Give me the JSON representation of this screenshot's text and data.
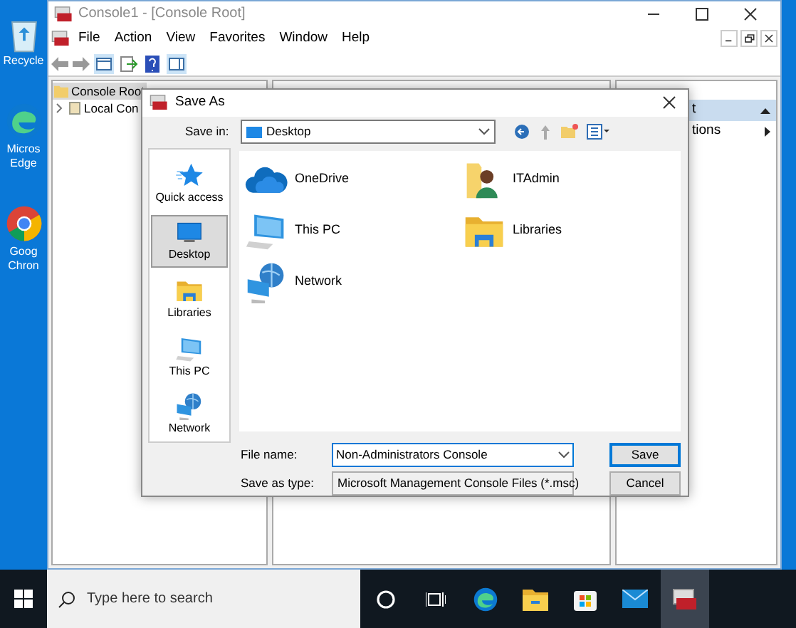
{
  "desktop_icons": [
    {
      "kind": "recycle",
      "lines": [
        "Recycle"
      ]
    },
    {
      "kind": "edge",
      "lines": [
        "Micros",
        "Edge"
      ]
    },
    {
      "kind": "chrome",
      "lines": [
        "Goog",
        "Chron"
      ]
    }
  ],
  "console": {
    "title": "Console1 - [Console Root]",
    "menu": [
      "File",
      "Action",
      "View",
      "Favorites",
      "Window",
      "Help"
    ],
    "tree": [
      {
        "label": "Console Root",
        "selected": true,
        "children": [
          {
            "label": "Local Con"
          }
        ]
      }
    ],
    "actions": [
      {
        "kind": "header",
        "label": "t"
      },
      {
        "kind": "item",
        "label": "tions"
      }
    ]
  },
  "dialog": {
    "title": "Save As",
    "save_in": {
      "label": "Save in:",
      "value": "Desktop"
    },
    "places": [
      {
        "kind": "star",
        "label": "Quick access",
        "selected": false
      },
      {
        "kind": "desktop",
        "label": "Desktop",
        "selected": true
      },
      {
        "kind": "library",
        "label": "Libraries",
        "selected": false
      },
      {
        "kind": "computer",
        "label": "This PC",
        "selected": false
      },
      {
        "kind": "network",
        "label": "Network",
        "selected": false
      }
    ],
    "files": [
      {
        "kind": "cloud",
        "name": "OneDrive"
      },
      {
        "kind": "user",
        "name": "ITAdmin"
      },
      {
        "kind": "computer",
        "name": "This PC"
      },
      {
        "kind": "library",
        "name": "Libraries"
      },
      {
        "kind": "network",
        "name": "Network"
      }
    ],
    "file_name": {
      "label": "File name:",
      "value": "Non-Administrators Console"
    },
    "save_as_type": {
      "label": "Save as type:",
      "value": "Microsoft Management Console Files (*.msc)"
    },
    "buttons": [
      {
        "label": "Save",
        "default": true
      },
      {
        "label": "Cancel",
        "default": false
      }
    ]
  },
  "taskbar": {
    "search": {
      "placeholder": "Type here to search"
    },
    "apps": [
      {
        "kind": "cortana",
        "active": false
      },
      {
        "kind": "taskview",
        "active": false
      },
      {
        "kind": "edge",
        "active": false
      },
      {
        "kind": "explorer",
        "active": false
      },
      {
        "kind": "store",
        "active": false
      },
      {
        "kind": "mail",
        "active": false
      },
      {
        "kind": "mmc",
        "active": true
      }
    ]
  }
}
